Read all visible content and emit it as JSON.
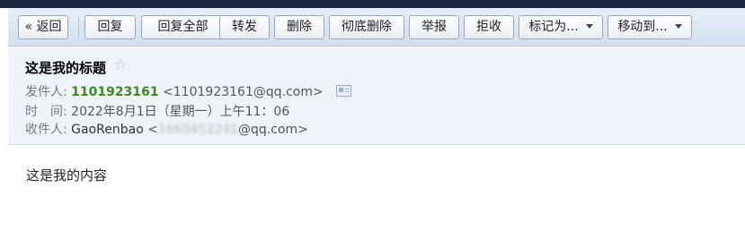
{
  "toolbar": {
    "back": "« 返回",
    "reply": "回复",
    "reply_all": "回复全部",
    "forward": "转发",
    "delete": "删除",
    "delete_permanently": "彻底删除",
    "report": "举报",
    "reject": "拒收",
    "mark_as": "标记为...",
    "move_to": "移动到..."
  },
  "email": {
    "subject": "这是我的标题",
    "star": "☆",
    "from_label": "发件人:",
    "from_name": "1101923161",
    "from_address": "<1101923161@qq.com>",
    "time_label": "时　间:",
    "time_value": "2022年8月1日（星期一）上午11：06",
    "to_label": "收件人:",
    "to_name": "GaoRenbao",
    "to_address_prefix": "<",
    "to_address_hidden": "1660452245",
    "to_address_suffix": "@qq.com>",
    "body": "这是我的内容"
  },
  "icons": {
    "star": "star-outline-icon",
    "contact_card": "contact-card-icon",
    "dropdown": "chevron-down-icon"
  },
  "colors": {
    "sender_name": "#3d8b1e",
    "toolbar_bg": "#d3dff0",
    "header_bg": "#eef3fa"
  }
}
